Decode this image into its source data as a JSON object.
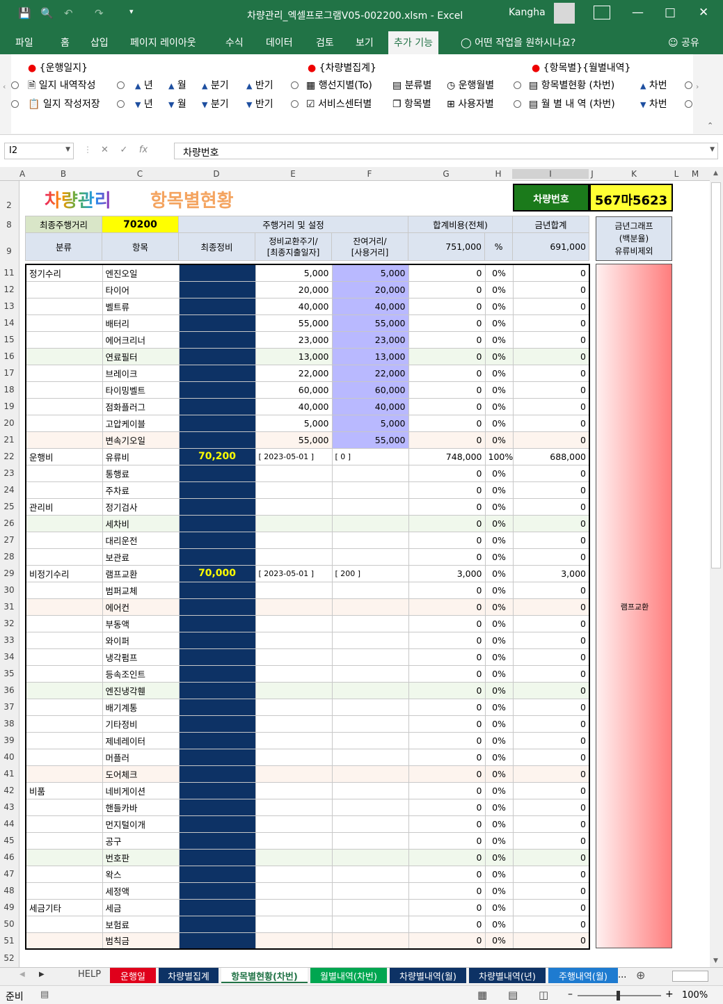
{
  "window": {
    "title": "차량관리_엑셀프로그램V05-002200.xlsm  -  Excel",
    "user": "Kangha"
  },
  "menu": {
    "tabs": [
      "파일",
      "홈",
      "삽입",
      "페이지 레이아웃",
      "수식",
      "데이터",
      "검토",
      "보기",
      "추가 기능"
    ],
    "tell_me": "어떤 작업을 원하시나요?",
    "share": "공유"
  },
  "ribbon": {
    "group1": {
      "title": "{운행일지}",
      "btn1": "일지 내역작성",
      "btn2": "일지 작성저장"
    },
    "nav": {
      "year": "년",
      "month": "월",
      "quarter": "분기",
      "half": "반기"
    },
    "group2": {
      "title": "{차량별집계}",
      "btn1": "행선지별(To)",
      "btn2": "서비스센터별",
      "btn3": "분류별",
      "btn4": "항목별",
      "btn5": "운행월별",
      "btn6": "사용자별"
    },
    "group3": {
      "title": "{항목별}{월별내역}",
      "btn1": "항목별현황 (차번)",
      "btn2": "월 별 내 역 (차번)",
      "btn3": "차번",
      "btn4": "차번"
    }
  },
  "formula": {
    "namebox": "I2",
    "content": "차량번호"
  },
  "columns": [
    "A",
    "B",
    "C",
    "D",
    "E",
    "F",
    "G",
    "H",
    "I",
    "J",
    "K",
    "L",
    "M"
  ],
  "sheet": {
    "logo": "차량관리",
    "subtitle": "항목별현황",
    "car_label": "차량번호",
    "car_number": "567마5623",
    "h8": {
      "last_mileage_label": "최종주행거리",
      "last_mileage": "70200",
      "mileage_setting": "주행거리 및 설정",
      "total_cost": "합계비용(전체)",
      "year_total": "금년합계"
    },
    "h9": {
      "category": "분류",
      "item": "항목",
      "last_service": "최종정비",
      "cycle": "정비교환주기/\n[최종지출일자]",
      "remaining": "잔여거리/\n[사용거리]",
      "total": "751,000",
      "pct": "%",
      "year_sum": "691,000"
    },
    "graph_header": "금년그래프\n(백분율)\n유류비제외",
    "graph_label": "램프교환",
    "rows": [
      {
        "r": "11",
        "cat": "정기수리",
        "item": "엔진오일",
        "d": "",
        "e": "5,000",
        "f": "5,000",
        "g": "0",
        "h": "0%",
        "i": "0",
        "blue": true
      },
      {
        "r": "12",
        "cat": "",
        "item": "타이어",
        "d": "",
        "e": "20,000",
        "f": "20,000",
        "g": "0",
        "h": "0%",
        "i": "0",
        "blue": true
      },
      {
        "r": "13",
        "cat": "",
        "item": "벨트류",
        "d": "",
        "e": "40,000",
        "f": "40,000",
        "g": "0",
        "h": "0%",
        "i": "0",
        "blue": true
      },
      {
        "r": "14",
        "cat": "",
        "item": "배터리",
        "d": "",
        "e": "55,000",
        "f": "55,000",
        "g": "0",
        "h": "0%",
        "i": "0",
        "blue": true
      },
      {
        "r": "15",
        "cat": "",
        "item": "에어크리너",
        "d": "",
        "e": "23,000",
        "f": "23,000",
        "g": "0",
        "h": "0%",
        "i": "0",
        "blue": true
      },
      {
        "r": "16",
        "cat": "",
        "item": "연료필터",
        "d": "",
        "e": "13,000",
        "f": "13,000",
        "g": "0",
        "h": "0%",
        "i": "0",
        "blue": true
      },
      {
        "r": "17",
        "cat": "",
        "item": "브레이크",
        "d": "",
        "e": "22,000",
        "f": "22,000",
        "g": "0",
        "h": "0%",
        "i": "0",
        "blue": true
      },
      {
        "r": "18",
        "cat": "",
        "item": "타이밍벨트",
        "d": "",
        "e": "60,000",
        "f": "60,000",
        "g": "0",
        "h": "0%",
        "i": "0",
        "blue": true
      },
      {
        "r": "19",
        "cat": "",
        "item": "점화플러그",
        "d": "",
        "e": "40,000",
        "f": "40,000",
        "g": "0",
        "h": "0%",
        "i": "0",
        "blue": true
      },
      {
        "r": "20",
        "cat": "",
        "item": "고압케이블",
        "d": "",
        "e": "5,000",
        "f": "5,000",
        "g": "0",
        "h": "0%",
        "i": "0",
        "blue": true
      },
      {
        "r": "21",
        "cat": "",
        "item": "변속기오일",
        "d": "",
        "e": "55,000",
        "f": "55,000",
        "g": "0",
        "h": "0%",
        "i": "0",
        "blue": true
      },
      {
        "r": "22",
        "cat": "운행비",
        "item": "유류비",
        "d": "70,200",
        "e": "[ 2023-05-01 ]",
        "f": "[ 0 ]",
        "g": "748,000",
        "h": "100%",
        "i": "688,000",
        "blue": false
      },
      {
        "r": "23",
        "cat": "",
        "item": "통행료",
        "d": "",
        "e": "",
        "f": "",
        "g": "0",
        "h": "0%",
        "i": "0",
        "blue": false
      },
      {
        "r": "24",
        "cat": "",
        "item": "주차료",
        "d": "",
        "e": "",
        "f": "",
        "g": "0",
        "h": "0%",
        "i": "0",
        "blue": false
      },
      {
        "r": "25",
        "cat": "관리비",
        "item": "정기검사",
        "d": "",
        "e": "",
        "f": "",
        "g": "0",
        "h": "0%",
        "i": "0",
        "blue": false
      },
      {
        "r": "26",
        "cat": "",
        "item": "세차비",
        "d": "",
        "e": "",
        "f": "",
        "g": "0",
        "h": "0%",
        "i": "0",
        "blue": false
      },
      {
        "r": "27",
        "cat": "",
        "item": "대리운전",
        "d": "",
        "e": "",
        "f": "",
        "g": "0",
        "h": "0%",
        "i": "0",
        "blue": false
      },
      {
        "r": "28",
        "cat": "",
        "item": "보관료",
        "d": "",
        "e": "",
        "f": "",
        "g": "0",
        "h": "0%",
        "i": "0",
        "blue": false
      },
      {
        "r": "29",
        "cat": "비정기수리",
        "item": "램프교환",
        "d": "70,000",
        "e": "[ 2023-05-01 ]",
        "f": "[ 200 ]",
        "g": "3,000",
        "h": "0%",
        "i": "3,000",
        "blue": false
      },
      {
        "r": "30",
        "cat": "",
        "item": "범퍼교체",
        "d": "",
        "e": "",
        "f": "",
        "g": "0",
        "h": "0%",
        "i": "0",
        "blue": false
      },
      {
        "r": "31",
        "cat": "",
        "item": "에어컨",
        "d": "",
        "e": "",
        "f": "",
        "g": "0",
        "h": "0%",
        "i": "0",
        "blue": false
      },
      {
        "r": "32",
        "cat": "",
        "item": "부동액",
        "d": "",
        "e": "",
        "f": "",
        "g": "0",
        "h": "0%",
        "i": "0",
        "blue": false
      },
      {
        "r": "33",
        "cat": "",
        "item": "와이퍼",
        "d": "",
        "e": "",
        "f": "",
        "g": "0",
        "h": "0%",
        "i": "0",
        "blue": false
      },
      {
        "r": "34",
        "cat": "",
        "item": "냉각펌프",
        "d": "",
        "e": "",
        "f": "",
        "g": "0",
        "h": "0%",
        "i": "0",
        "blue": false
      },
      {
        "r": "35",
        "cat": "",
        "item": "등속조인트",
        "d": "",
        "e": "",
        "f": "",
        "g": "0",
        "h": "0%",
        "i": "0",
        "blue": false
      },
      {
        "r": "36",
        "cat": "",
        "item": "엔진냉각휀",
        "d": "",
        "e": "",
        "f": "",
        "g": "0",
        "h": "0%",
        "i": "0",
        "blue": false
      },
      {
        "r": "37",
        "cat": "",
        "item": "배기계통",
        "d": "",
        "e": "",
        "f": "",
        "g": "0",
        "h": "0%",
        "i": "0",
        "blue": false
      },
      {
        "r": "38",
        "cat": "",
        "item": "기타정비",
        "d": "",
        "e": "",
        "f": "",
        "g": "0",
        "h": "0%",
        "i": "0",
        "blue": false
      },
      {
        "r": "39",
        "cat": "",
        "item": "제네레이터",
        "d": "",
        "e": "",
        "f": "",
        "g": "0",
        "h": "0%",
        "i": "0",
        "blue": false
      },
      {
        "r": "40",
        "cat": "",
        "item": "머플러",
        "d": "",
        "e": "",
        "f": "",
        "g": "0",
        "h": "0%",
        "i": "0",
        "blue": false
      },
      {
        "r": "41",
        "cat": "",
        "item": "도어체크",
        "d": "",
        "e": "",
        "f": "",
        "g": "0",
        "h": "0%",
        "i": "0",
        "blue": false
      },
      {
        "r": "42",
        "cat": "비품",
        "item": "네비게이션",
        "d": "",
        "e": "",
        "f": "",
        "g": "0",
        "h": "0%",
        "i": "0",
        "blue": false
      },
      {
        "r": "43",
        "cat": "",
        "item": "핸들카바",
        "d": "",
        "e": "",
        "f": "",
        "g": "0",
        "h": "0%",
        "i": "0",
        "blue": false
      },
      {
        "r": "44",
        "cat": "",
        "item": "먼지털이개",
        "d": "",
        "e": "",
        "f": "",
        "g": "0",
        "h": "0%",
        "i": "0",
        "blue": false
      },
      {
        "r": "45",
        "cat": "",
        "item": "공구",
        "d": "",
        "e": "",
        "f": "",
        "g": "0",
        "h": "0%",
        "i": "0",
        "blue": false
      },
      {
        "r": "46",
        "cat": "",
        "item": "번호판",
        "d": "",
        "e": "",
        "f": "",
        "g": "0",
        "h": "0%",
        "i": "0",
        "blue": false
      },
      {
        "r": "47",
        "cat": "",
        "item": "왁스",
        "d": "",
        "e": "",
        "f": "",
        "g": "0",
        "h": "0%",
        "i": "0",
        "blue": false
      },
      {
        "r": "48",
        "cat": "",
        "item": "세정액",
        "d": "",
        "e": "",
        "f": "",
        "g": "0",
        "h": "0%",
        "i": "0",
        "blue": false
      },
      {
        "r": "49",
        "cat": "세금기타",
        "item": "세금",
        "d": "",
        "e": "",
        "f": "",
        "g": "0",
        "h": "0%",
        "i": "0",
        "blue": false
      },
      {
        "r": "50",
        "cat": "",
        "item": "보험료",
        "d": "",
        "e": "",
        "f": "",
        "g": "0",
        "h": "0%",
        "i": "0",
        "blue": false
      },
      {
        "r": "51",
        "cat": "",
        "item": "범칙금",
        "d": "",
        "e": "",
        "f": "",
        "g": "0",
        "h": "0%",
        "i": "0",
        "blue": false
      }
    ]
  },
  "sheet_tabs": [
    {
      "label": "HELP",
      "color": "#f0f0f0",
      "text": "#444"
    },
    {
      "label": "운행일지",
      "color": "#e0001b",
      "text": "#fff"
    },
    {
      "label": "차량별집계",
      "color": "#0d3265",
      "text": "#fff"
    },
    {
      "label": "항목별현황(차번)",
      "color": "#ffffff",
      "text": "#217346"
    },
    {
      "label": "월별내역(차번)",
      "color": "#00a650",
      "text": "#fff"
    },
    {
      "label": "차량별내역(월)",
      "color": "#0d3265",
      "text": "#fff"
    },
    {
      "label": "차량별내역(년)",
      "color": "#0d3265",
      "text": "#fff"
    },
    {
      "label": "주행내역(월)",
      "color": "#1e7bd0",
      "text": "#fff"
    }
  ],
  "status": {
    "ready": "준비",
    "zoom": "100%",
    "more": "..."
  }
}
